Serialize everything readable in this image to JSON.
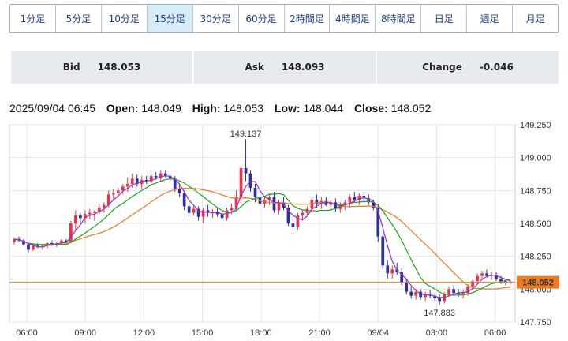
{
  "tabs": [
    {
      "label": "1分足",
      "active": false
    },
    {
      "label": "5分足",
      "active": false
    },
    {
      "label": "10分足",
      "active": false
    },
    {
      "label": "15分足",
      "active": true
    },
    {
      "label": "30分足",
      "active": false
    },
    {
      "label": "60分足",
      "active": false
    },
    {
      "label": "2時間足",
      "active": false
    },
    {
      "label": "4時間足",
      "active": false
    },
    {
      "label": "8時間足",
      "active": false
    },
    {
      "label": "日足",
      "active": false
    },
    {
      "label": "週足",
      "active": false
    },
    {
      "label": "月足",
      "active": false
    }
  ],
  "quote": {
    "bid_label": "Bid",
    "bid": "148.053",
    "ask_label": "Ask",
    "ask": "148.093",
    "change_label": "Change",
    "change": "-0.046"
  },
  "ohlc": {
    "datetime": "2025/09/04 06:45",
    "open_label": "Open:",
    "open": "148.049",
    "high_label": "High:",
    "high": "148.053",
    "low_label": "Low:",
    "low": "148.044",
    "close_label": "Close:",
    "close": "148.052"
  },
  "colors": {
    "up": "#e8334a",
    "down": "#2b2fa6",
    "ma_short": "#9b2fc9",
    "ma_mid": "#18a81a",
    "ma_long": "#ef7a1e",
    "current_line": "#ef7a1e",
    "price_tag": "#ef7a1e",
    "high_label": "#e04060",
    "low_label": "#2a5aa8"
  },
  "chart_data": {
    "type": "candlestick",
    "ylim": [
      147.75,
      149.25
    ],
    "y_ticks": [
      "147.750",
      "148.000",
      "148.250",
      "148.500",
      "148.750",
      "149.000",
      "149.250"
    ],
    "x_ticks": [
      "06:00",
      "09:00",
      "12:00",
      "15:00",
      "18:00",
      "21:00",
      "09/04",
      "03:00",
      "06:00"
    ],
    "current_price": "148.052",
    "high_marker": {
      "label": "149.137",
      "value": 149.137
    },
    "low_marker": {
      "label": "147.883",
      "value": 147.883
    },
    "grid": true,
    "candles": [
      [
        148.36,
        148.39,
        148.34,
        148.38
      ],
      [
        148.38,
        148.4,
        148.36,
        148.37
      ],
      [
        148.37,
        148.38,
        148.33,
        148.34
      ],
      [
        148.34,
        148.35,
        148.28,
        148.3
      ],
      [
        148.3,
        148.34,
        148.29,
        148.33
      ],
      [
        148.33,
        148.35,
        148.31,
        148.32
      ],
      [
        148.32,
        148.34,
        148.3,
        148.33
      ],
      [
        148.33,
        148.36,
        148.31,
        148.35
      ],
      [
        148.35,
        148.37,
        148.33,
        148.34
      ],
      [
        148.34,
        148.36,
        148.32,
        148.35
      ],
      [
        148.35,
        148.38,
        148.34,
        148.37
      ],
      [
        148.37,
        148.38,
        148.35,
        148.36
      ],
      [
        148.36,
        148.52,
        148.35,
        148.5
      ],
      [
        148.5,
        148.6,
        148.45,
        148.56
      ],
      [
        148.56,
        148.58,
        148.5,
        148.54
      ],
      [
        148.54,
        148.6,
        148.5,
        148.57
      ],
      [
        148.57,
        148.61,
        148.53,
        148.58
      ],
      [
        148.58,
        148.6,
        148.52,
        148.59
      ],
      [
        148.59,
        148.65,
        148.57,
        148.62
      ],
      [
        148.62,
        148.66,
        148.58,
        148.64
      ],
      [
        148.64,
        148.75,
        148.62,
        148.72
      ],
      [
        148.72,
        148.76,
        148.68,
        148.73
      ],
      [
        148.73,
        148.77,
        148.7,
        148.75
      ],
      [
        148.75,
        148.8,
        148.72,
        148.78
      ],
      [
        148.78,
        148.85,
        148.74,
        148.8
      ],
      [
        148.8,
        148.88,
        148.77,
        148.84
      ],
      [
        148.84,
        148.87,
        148.78,
        148.8
      ],
      [
        148.8,
        148.86,
        148.76,
        148.83
      ],
      [
        148.83,
        148.86,
        148.8,
        148.82
      ],
      [
        148.82,
        148.88,
        148.79,
        148.86
      ],
      [
        148.86,
        148.89,
        148.83,
        148.85
      ],
      [
        148.85,
        148.9,
        148.82,
        148.88
      ],
      [
        148.88,
        148.9,
        148.85,
        148.86
      ],
      [
        148.86,
        148.88,
        148.82,
        148.84
      ],
      [
        148.84,
        148.86,
        148.74,
        148.76
      ],
      [
        148.76,
        148.8,
        148.7,
        148.73
      ],
      [
        148.73,
        148.75,
        148.6,
        148.63
      ],
      [
        148.63,
        148.66,
        148.55,
        148.58
      ],
      [
        148.58,
        148.63,
        148.56,
        148.61
      ],
      [
        148.61,
        148.63,
        148.52,
        148.55
      ],
      [
        148.55,
        148.62,
        148.5,
        148.6
      ],
      [
        148.6,
        148.64,
        148.55,
        148.58
      ],
      [
        148.58,
        148.61,
        148.54,
        148.59
      ],
      [
        148.59,
        148.62,
        148.55,
        148.57
      ],
      [
        148.57,
        148.6,
        148.52,
        148.54
      ],
      [
        148.54,
        148.62,
        148.52,
        148.6
      ],
      [
        148.6,
        148.65,
        148.57,
        148.62
      ],
      [
        148.62,
        148.75,
        148.6,
        148.7
      ],
      [
        148.7,
        148.95,
        148.65,
        148.92
      ],
      [
        148.92,
        149.14,
        148.82,
        148.88
      ],
      [
        148.88,
        148.9,
        148.74,
        148.77
      ],
      [
        148.77,
        148.8,
        148.66,
        148.7
      ],
      [
        148.7,
        148.74,
        148.63,
        148.65
      ],
      [
        148.65,
        148.71,
        148.62,
        148.68
      ],
      [
        148.68,
        148.72,
        148.64,
        148.7
      ],
      [
        148.7,
        148.74,
        148.58,
        148.6
      ],
      [
        148.6,
        148.68,
        148.57,
        148.66
      ],
      [
        148.66,
        148.7,
        148.6,
        148.62
      ],
      [
        148.62,
        148.64,
        148.48,
        148.5
      ],
      [
        148.5,
        148.56,
        148.44,
        148.47
      ],
      [
        148.47,
        148.58,
        148.45,
        148.56
      ],
      [
        148.56,
        148.6,
        148.52,
        148.58
      ],
      [
        148.58,
        148.63,
        148.55,
        148.61
      ],
      [
        148.61,
        148.7,
        148.58,
        148.68
      ],
      [
        148.68,
        148.72,
        148.62,
        148.65
      ],
      [
        148.65,
        148.7,
        148.61,
        148.67
      ],
      [
        148.67,
        148.7,
        148.63,
        148.64
      ],
      [
        148.64,
        148.68,
        148.6,
        148.66
      ],
      [
        148.66,
        148.69,
        148.59,
        148.61
      ],
      [
        148.61,
        148.66,
        148.58,
        148.64
      ],
      [
        148.64,
        148.68,
        148.6,
        148.66
      ],
      [
        148.66,
        148.72,
        148.62,
        148.7
      ],
      [
        148.7,
        148.74,
        148.66,
        148.68
      ],
      [
        148.68,
        148.73,
        148.64,
        148.71
      ],
      [
        148.71,
        148.74,
        148.66,
        148.69
      ],
      [
        148.69,
        148.72,
        148.64,
        148.66
      ],
      [
        148.66,
        148.68,
        148.6,
        148.62
      ],
      [
        148.62,
        148.65,
        148.36,
        148.4
      ],
      [
        148.4,
        148.42,
        148.15,
        148.18
      ],
      [
        148.18,
        148.22,
        148.08,
        148.12
      ],
      [
        148.12,
        148.18,
        148.08,
        148.15
      ],
      [
        148.15,
        148.2,
        148.11,
        148.13
      ],
      [
        148.13,
        148.16,
        148.03,
        148.05
      ],
      [
        148.05,
        148.08,
        147.96,
        147.98
      ],
      [
        147.98,
        148.02,
        147.93,
        147.95
      ],
      [
        147.95,
        148.0,
        147.92,
        147.98
      ],
      [
        147.98,
        148.0,
        147.92,
        147.94
      ],
      [
        147.94,
        147.98,
        147.91,
        147.96
      ],
      [
        147.96,
        147.99,
        147.93,
        147.95
      ],
      [
        147.95,
        147.97,
        147.91,
        147.93
      ],
      [
        147.93,
        147.96,
        147.88,
        147.91
      ],
      [
        147.91,
        147.98,
        147.89,
        147.96
      ],
      [
        147.96,
        148.02,
        147.94,
        148.0
      ],
      [
        148.0,
        148.03,
        147.95,
        147.97
      ],
      [
        147.97,
        148.0,
        147.94,
        147.96
      ],
      [
        147.96,
        147.99,
        147.93,
        147.97
      ],
      [
        147.97,
        148.04,
        147.95,
        148.02
      ],
      [
        148.02,
        148.08,
        148.0,
        148.06
      ],
      [
        148.06,
        148.12,
        148.04,
        148.1
      ],
      [
        148.1,
        148.14,
        148.07,
        148.12
      ],
      [
        148.12,
        148.15,
        148.09,
        148.1
      ],
      [
        148.1,
        148.13,
        148.07,
        148.11
      ],
      [
        148.11,
        148.13,
        148.06,
        148.08
      ],
      [
        148.08,
        148.1,
        148.04,
        148.06
      ],
      [
        148.06,
        148.08,
        148.03,
        148.05
      ],
      [
        148.05,
        148.07,
        148.04,
        148.05
      ]
    ]
  }
}
